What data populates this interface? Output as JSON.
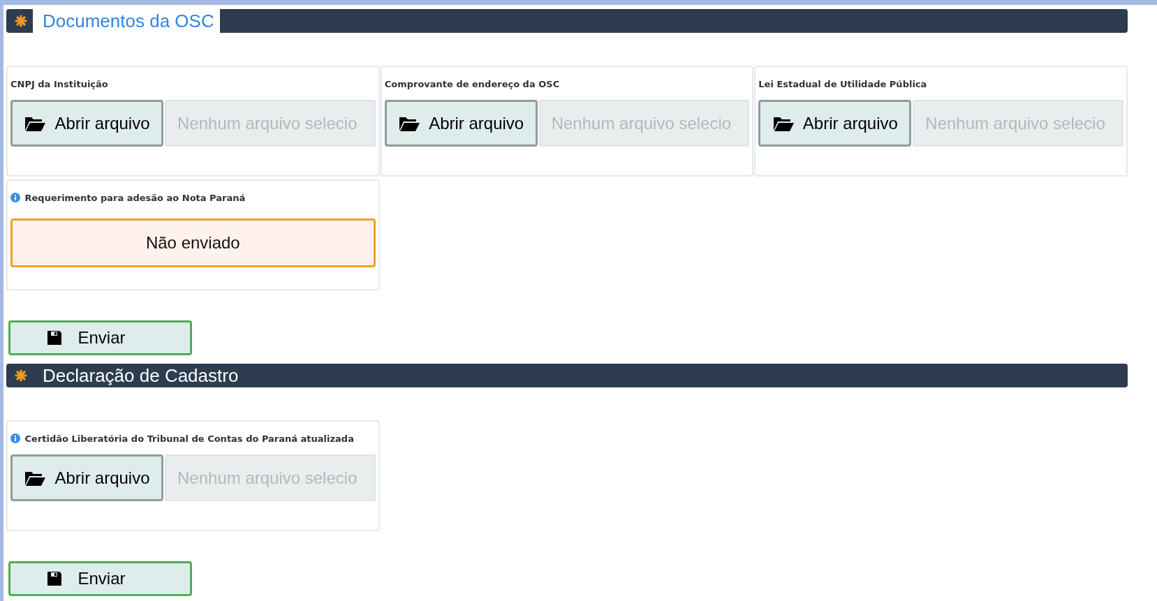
{
  "sections": [
    {
      "title": "Documentos da OSC",
      "highlighted": true,
      "submit": "Enviar",
      "fields": [
        {
          "kind": "file",
          "label": "CNPJ da Instituição",
          "info": false,
          "button": "Abrir arquivo",
          "placeholder": "Nenhum arquivo selecio"
        },
        {
          "kind": "file",
          "label": "Comprovante de endereço da OSC",
          "info": false,
          "button": "Abrir arquivo",
          "placeholder": "Nenhum arquivo selecio"
        },
        {
          "kind": "file",
          "label": "Lei Estadual de Utilidade Pública",
          "info": false,
          "button": "Abrir arquivo",
          "placeholder": "Nenhum arquivo selecio"
        },
        {
          "kind": "status",
          "label": "Requerimento para adesão ao Nota Paraná",
          "info": true,
          "status": "Não enviado"
        }
      ]
    },
    {
      "title": "Declaração de Cadastro",
      "highlighted": false,
      "submit": "Enviar",
      "fields": [
        {
          "kind": "file",
          "label": "Certidão Liberatória do Tribunal de Contas do Paraná atualizada",
          "info": true,
          "button": "Abrir arquivo",
          "placeholder": "Nenhum arquivo selecio"
        }
      ]
    }
  ]
}
